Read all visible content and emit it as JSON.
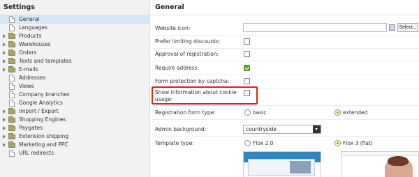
{
  "sidebar": {
    "title": "Settings",
    "items": [
      {
        "label": "General",
        "type": "file",
        "expandable": false,
        "selected": true
      },
      {
        "label": "Languages",
        "type": "file",
        "expandable": false
      },
      {
        "label": "Products",
        "type": "folder",
        "expandable": true
      },
      {
        "label": "Warehouses",
        "type": "folder",
        "expandable": true
      },
      {
        "label": "Orders",
        "type": "folder",
        "expandable": true
      },
      {
        "label": "Texts and templates",
        "type": "folder",
        "expandable": true
      },
      {
        "label": "E-mails",
        "type": "folder",
        "expandable": true
      },
      {
        "label": "Addresses",
        "type": "file",
        "expandable": false
      },
      {
        "label": "Views",
        "type": "file",
        "expandable": false
      },
      {
        "label": "Company branches",
        "type": "file",
        "expandable": false
      },
      {
        "label": "Google Analytics",
        "type": "file",
        "expandable": false
      },
      {
        "label": "Import / Export",
        "type": "folder",
        "expandable": true
      },
      {
        "label": "Shopping Engines",
        "type": "folder",
        "expandable": true
      },
      {
        "label": "Paygates",
        "type": "folder",
        "expandable": true
      },
      {
        "label": "Extension shipping",
        "type": "folder",
        "expandable": true
      },
      {
        "label": "Marketing and PPC",
        "type": "folder",
        "expandable": true
      },
      {
        "label": "URL redirects",
        "type": "file",
        "expandable": false
      }
    ]
  },
  "main": {
    "title": "General",
    "website_icon": {
      "label": "Website icon:",
      "value": "",
      "select_button": "Select..."
    },
    "prefer_limiting_discounts": {
      "label": "Prefer limiting discounts:",
      "checked": false
    },
    "approval_of_registration": {
      "label": "Approval of registration:",
      "checked": false
    },
    "require_address": {
      "label": "Require address:",
      "checked": true
    },
    "form_protection": {
      "label": "Form protection by captcha:",
      "checked": false
    },
    "show_cookie_info": {
      "label_line1": "Show information about cookie",
      "label_line2": "usage:",
      "checked": false,
      "highlight_color": "#e0201a"
    },
    "registration_form_type": {
      "label": "Registration form type:",
      "options": [
        "basic",
        "extended"
      ],
      "selected": "extended"
    },
    "admin_background": {
      "label": "Admin background:",
      "value": "countryside"
    },
    "template_type": {
      "label": "Template type:",
      "options": [
        "Flox 2.0",
        "Flox 3 (flat)"
      ],
      "selected": "Flox 3 (flat)"
    }
  },
  "colors": {
    "accent": "#74a51e",
    "selection": "#d6e7f5",
    "highlight": "#e0201a"
  }
}
